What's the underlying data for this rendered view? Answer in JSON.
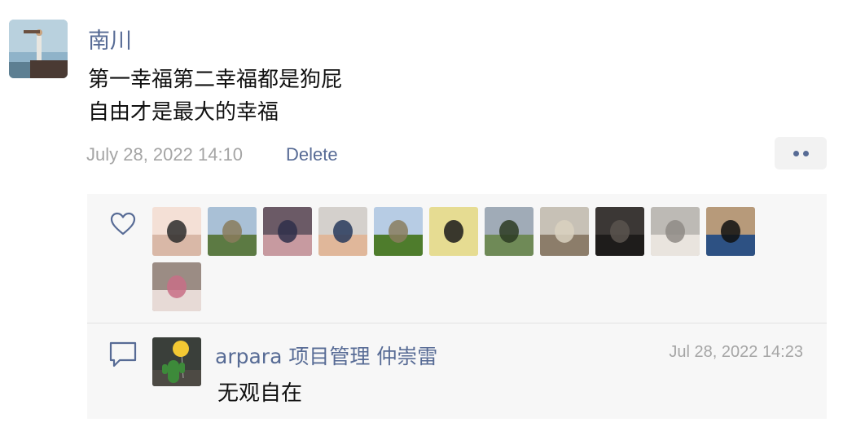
{
  "post": {
    "author": "南川",
    "lines": [
      "第一幸福第二幸福都是狗屁",
      "自由才是最大的幸福"
    ],
    "timestamp": "July 28, 2022 14:10",
    "delete_label": "Delete"
  },
  "likes": {
    "icon": "heart-icon",
    "count": 12,
    "users": [
      {
        "name": "liker-1",
        "colors": [
          "#f4e0d6",
          "#d9b8a7",
          "#2b2b2b"
        ]
      },
      {
        "name": "liker-2",
        "colors": [
          "#a9c0d6",
          "#5c7a43",
          "#8a7b5c"
        ]
      },
      {
        "name": "liker-3",
        "colors": [
          "#6b5a66",
          "#c79aa0",
          "#2e2f4a"
        ]
      },
      {
        "name": "liker-4",
        "colors": [
          "#d4d0cc",
          "#e0b79a",
          "#27395c"
        ]
      },
      {
        "name": "liker-5",
        "colors": [
          "#b7cce4",
          "#4e7c2c",
          "#8a7d5e"
        ]
      },
      {
        "name": "liker-6",
        "colors": [
          "#e6dc92",
          "#e6dc92",
          "#1a1a1a"
        ]
      },
      {
        "name": "liker-7",
        "colors": [
          "#a0abb7",
          "#6f8a57",
          "#2c3a22"
        ]
      },
      {
        "name": "liker-8",
        "colors": [
          "#c7c1b6",
          "#8c7d6a",
          "#d9d1c0"
        ]
      },
      {
        "name": "liker-9",
        "colors": [
          "#3b3735",
          "#1e1c1b",
          "#5a534d"
        ]
      },
      {
        "name": "liker-10",
        "colors": [
          "#bdbab5",
          "#e9e4de",
          "#8f8b86"
        ]
      },
      {
        "name": "liker-11",
        "colors": [
          "#b79a7a",
          "#2d5183",
          "#101010"
        ]
      },
      {
        "name": "liker-12",
        "colors": [
          "#9b8c84",
          "#e7dad6",
          "#c86f86"
        ]
      }
    ]
  },
  "comment": {
    "icon": "comment-icon",
    "author": "arpara 项目管理 仲崇雷",
    "time": "Jul 28, 2022 14:23",
    "text": "无观自在"
  }
}
